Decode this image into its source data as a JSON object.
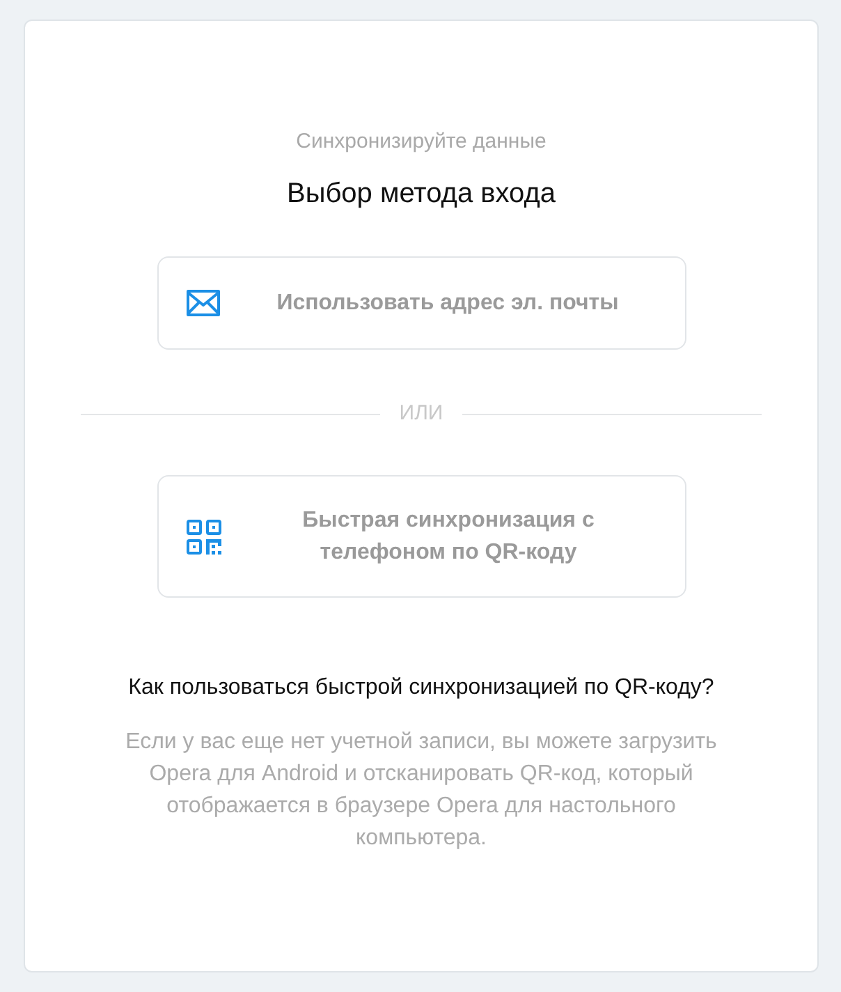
{
  "header": {
    "subtitle": "Синхронизируйте данные",
    "title": "Выбор метода входа"
  },
  "methods": [
    {
      "kind": "email",
      "label": "Использовать адрес эл. почты"
    },
    {
      "kind": "qr",
      "label": "Быстрая синхронизация с телефоном по QR-коду"
    }
  ],
  "separator": "ИЛИ",
  "help": {
    "question": "Как пользоваться быстрой синхронизацией по QR-коду?",
    "text": "Если у вас еще нет учетной записи, вы можете загрузить Opera для Android и отсканировать QR-код, который отображается в браузере Opera для настольного компьютера."
  }
}
